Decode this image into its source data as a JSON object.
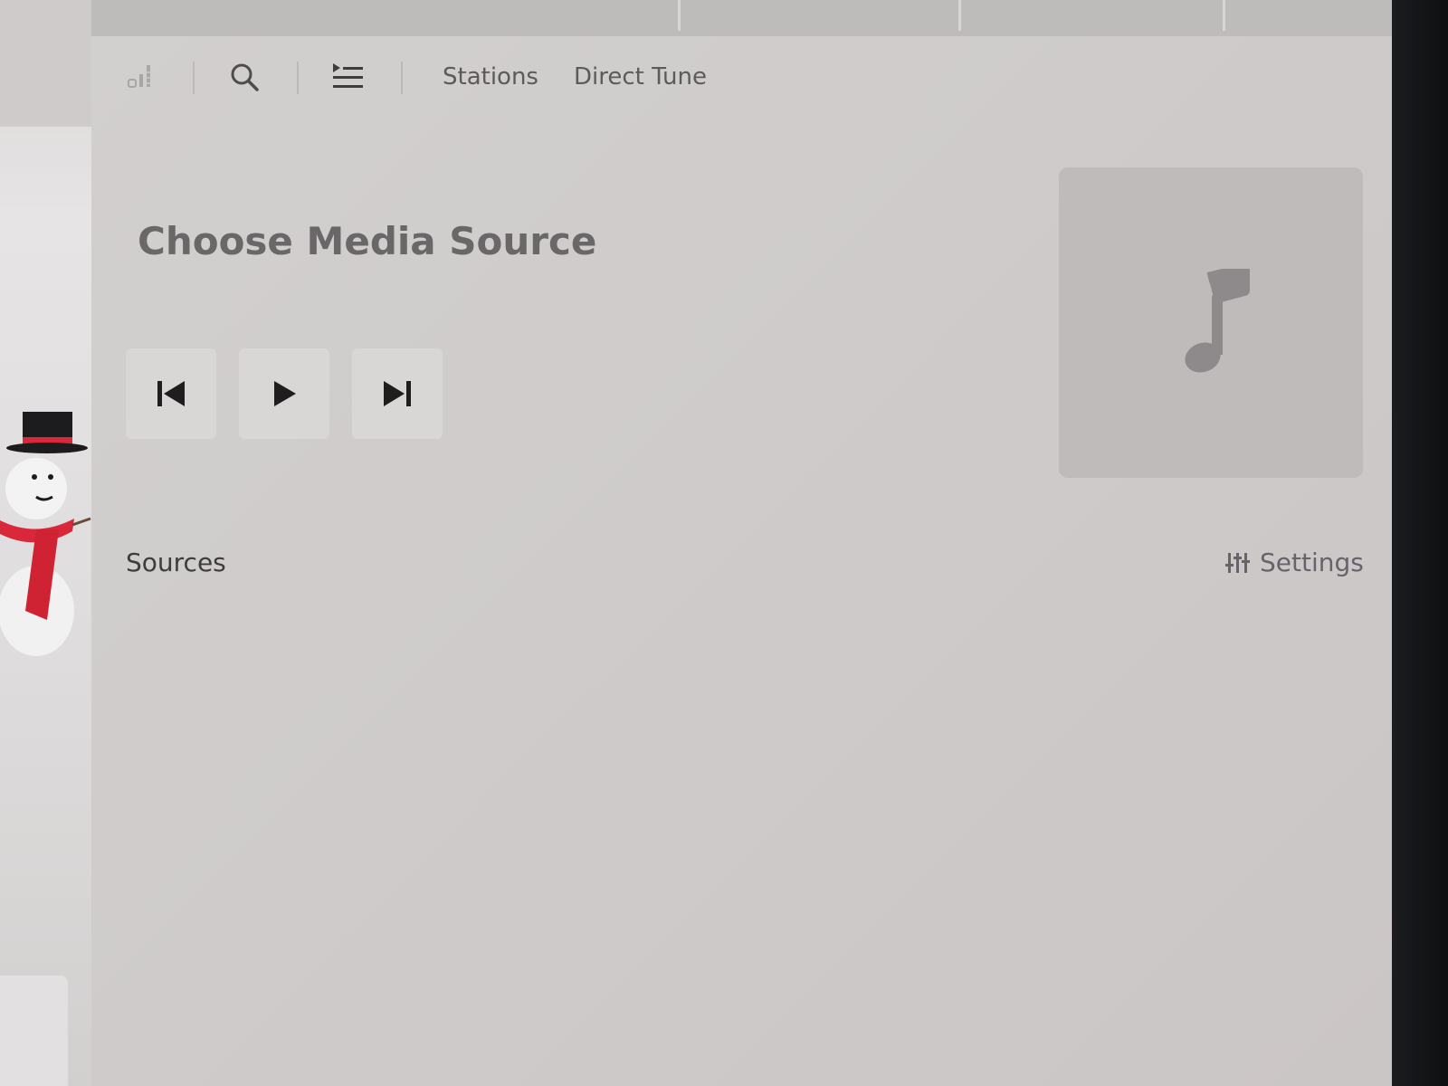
{
  "colors": {
    "panel_background": "#cfcbcb",
    "text_primary": "#3f3c3d",
    "text_secondary": "#5d5a5b",
    "button_background": "#d9d6d6",
    "album_placeholder": "#bfbbbb",
    "bezel": "#141518"
  },
  "toolbar": {
    "icons": {
      "equalizer": "equalizer-icon",
      "search": "search-icon",
      "queue": "queue-list-icon"
    },
    "tabs": [
      {
        "label": "Stations"
      },
      {
        "label": "Direct Tune"
      }
    ]
  },
  "main": {
    "title": "Choose Media Source",
    "controls": {
      "previous": "skip-previous-icon",
      "play": "play-icon",
      "next": "skip-next-icon"
    },
    "album_art_icon": "music-note-icon"
  },
  "sources": {
    "label": "Sources",
    "settings_label": "Settings",
    "settings_icon": "sliders-icon"
  }
}
